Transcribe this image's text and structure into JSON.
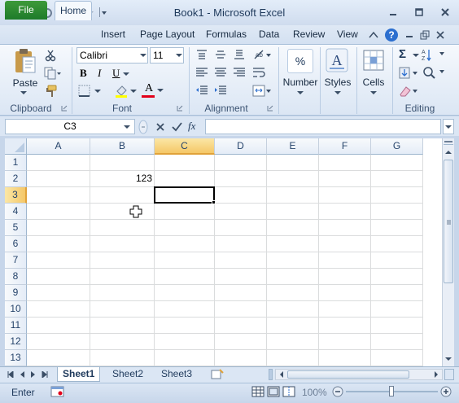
{
  "window": {
    "title": "Book1 - Microsoft Excel"
  },
  "tabs": {
    "file": "File",
    "home": "Home",
    "insert": "Insert",
    "page_layout": "Page Layout",
    "formulas": "Formulas",
    "data": "Data",
    "review": "Review",
    "view": "View"
  },
  "ribbon": {
    "clipboard": {
      "paste": "Paste",
      "label": "Clipboard"
    },
    "font": {
      "family": "Calibri",
      "size": "11",
      "label": "Font",
      "bold": "B",
      "italic": "I",
      "underline": "U",
      "font_color_letter": "A",
      "font_color": "#e2001a"
    },
    "alignment": {
      "label": "Alignment"
    },
    "number": {
      "button": "Number",
      "symbol": "%"
    },
    "styles": {
      "button": "Styles"
    },
    "cells": {
      "button": "Cells"
    },
    "editing": {
      "label": "Editing",
      "autosum": "Σ"
    }
  },
  "formula_bar": {
    "name_box": "C3",
    "fx": "fx",
    "formula": ""
  },
  "sheet": {
    "columns": [
      "A",
      "B",
      "C",
      "D",
      "E",
      "F",
      "G"
    ],
    "selected_column": "C",
    "rows": [
      "1",
      "2",
      "3",
      "4",
      "5",
      "6",
      "7",
      "8",
      "9",
      "10",
      "11",
      "12",
      "13"
    ],
    "selected_row": "3",
    "active_cell": "C3",
    "cells": {
      "B2": "123"
    }
  },
  "sheet_tabs": [
    "Sheet1",
    "Sheet2",
    "Sheet3"
  ],
  "active_sheet": "Sheet1",
  "status": {
    "mode": "Enter",
    "zoom": "100%"
  },
  "colors": {
    "file_tab": "#2a8a32",
    "selection_header": "#f5c767",
    "active_border": "#000000"
  }
}
